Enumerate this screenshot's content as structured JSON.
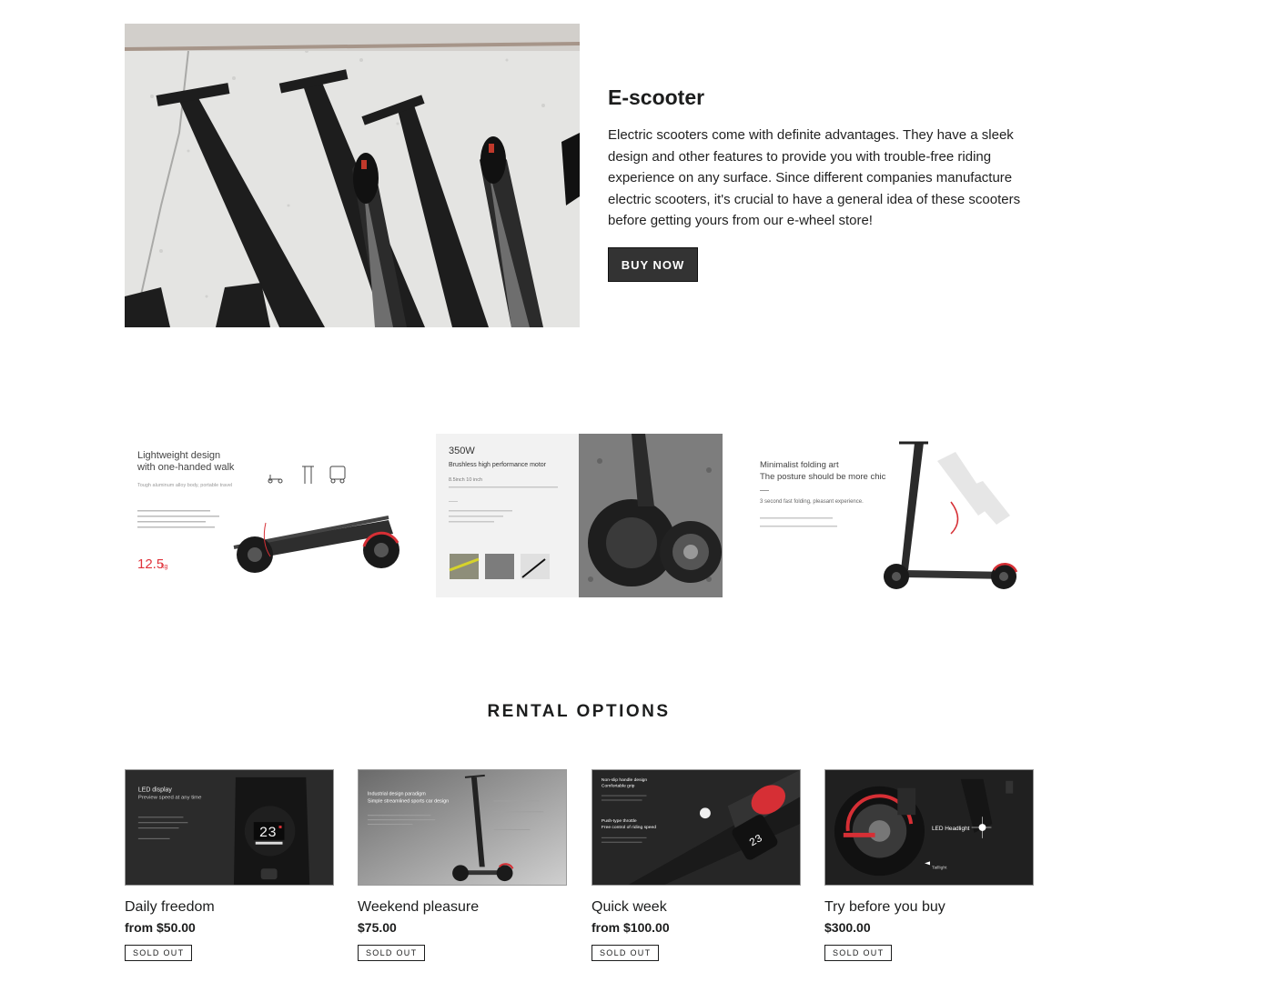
{
  "hero": {
    "title": "E-scooter",
    "description": "Electric scooters come with definite advantages. They have a sleek design and other features to provide you with trouble-free riding experience on any surface. Since different companies manufacture electric scooters, it's crucial to have a general idea of these scooters before getting yours from our e-wheel store!",
    "button_label": "BUY NOW"
  },
  "gallery": [
    {
      "line1": "Lightweight design",
      "line2": "with one-handed walk",
      "line3": "Tough aluminum alloy body, portable travel",
      "weight": "12.5",
      "weight_unit": "kg"
    },
    {
      "line1": "350W",
      "line2": "Brushless high performance motor",
      "line3": "8.5inch  10 inch"
    },
    {
      "line1": "Minimalist folding art",
      "line2": "The posture should be more chic",
      "line3": "3 second fast folding, pleasant experience."
    }
  ],
  "rental": {
    "heading": "RENTAL OPTIONS",
    "products": [
      {
        "title": "Daily freedom",
        "price": "from $50.00",
        "badge": "SOLD OUT",
        "img_text1": "LED display",
        "img_text2": "Preview speed at any time",
        "img_number": "23"
      },
      {
        "title": "Weekend pleasure",
        "price": "$75.00",
        "badge": "SOLD OUT",
        "img_text1": "Industrial design paradigm",
        "img_text2": "Simple streamlined sports car design"
      },
      {
        "title": "Quick week",
        "price": "from $100.00",
        "badge": "SOLD OUT",
        "img_text1": "Non-slip handle design",
        "img_text2": "Comfortable grip",
        "img_text3": "Push-type throttle",
        "img_text4": "Free control of riding speed",
        "img_number": "23"
      },
      {
        "title": "Try before you buy",
        "price": "$300.00",
        "badge": "SOLD OUT",
        "img_text1": "LED Headlight",
        "img_text2": "Taillight"
      }
    ]
  }
}
